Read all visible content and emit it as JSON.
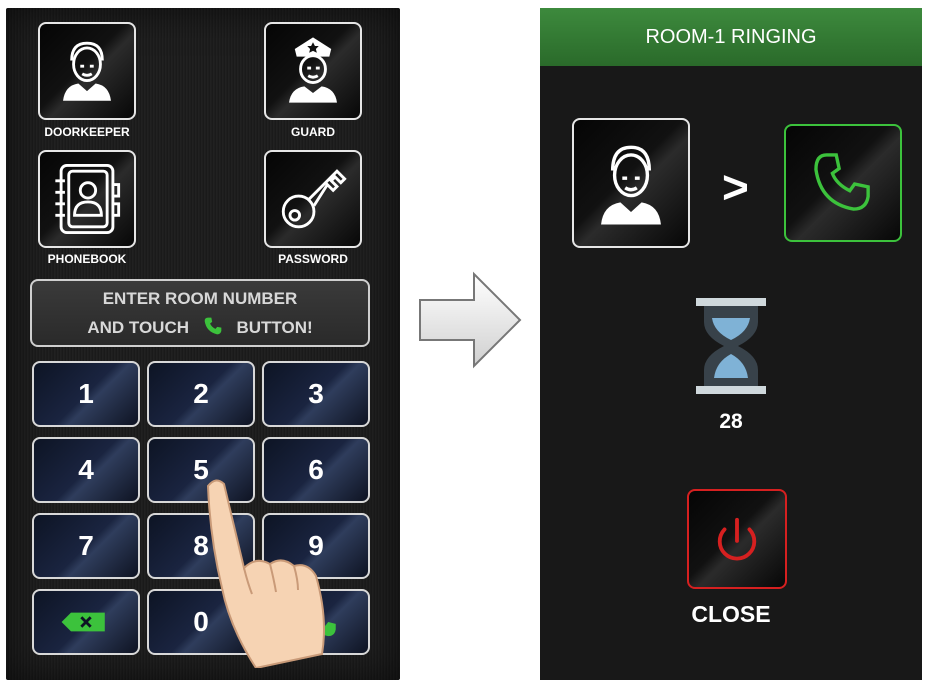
{
  "keypad_screen": {
    "tiles": {
      "doorkeeper": "DOORKEEPER",
      "guard": "GUARD",
      "phonebook": "PHONEBOOK",
      "password": "PASSWORD"
    },
    "instruction": {
      "line1": "ENTER ROOM NUMBER",
      "line2_before": "AND TOUCH",
      "line2_after": "BUTTON!"
    },
    "keys": [
      "1",
      "2",
      "3",
      "4",
      "5",
      "6",
      "7",
      "8",
      "9",
      "0"
    ]
  },
  "ringing_screen": {
    "title": "ROOM-1 RINGING",
    "arrow_glyph": ">",
    "countdown": "28",
    "close_label": "CLOSE"
  },
  "colors": {
    "call_green": "#3cc23c",
    "close_red": "#d62020",
    "header_green": "#357d35"
  },
  "icons": [
    "doorkeeper-icon",
    "guard-icon",
    "phonebook-icon",
    "key-icon",
    "phone-icon",
    "backspace-icon",
    "hourglass-icon",
    "power-icon"
  ]
}
